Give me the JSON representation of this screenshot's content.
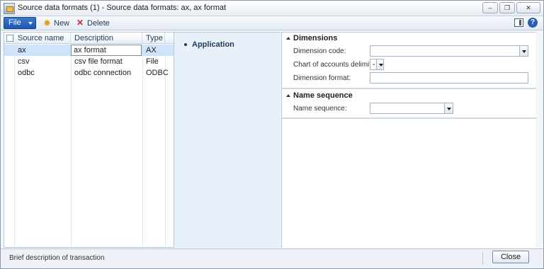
{
  "window": {
    "title": "Source data formats (1) - Source data formats: ax, ax format",
    "controls": [
      "minimize",
      "restore",
      "close"
    ]
  },
  "toolbar": {
    "file_label": "File",
    "new_label": "New",
    "delete_label": "Delete"
  },
  "grid": {
    "columns": [
      "Source name",
      "Description",
      "Type"
    ],
    "sort_column": "Source name",
    "rows": [
      {
        "name": "ax",
        "description": "ax format",
        "type": "AX",
        "selected": true
      },
      {
        "name": "csv",
        "description": "csv file format",
        "type": "File",
        "selected": false
      },
      {
        "name": "odbc",
        "description": "odbc connection",
        "type": "ODBC",
        "selected": false
      }
    ]
  },
  "nav": {
    "items": [
      "Application"
    ]
  },
  "detail": {
    "dimensions": {
      "title": "Dimensions",
      "dimension_code_label": "Dimension code:",
      "dimension_code_value": "",
      "delimiter_label": "Chart of accounts delimiter:",
      "delimiter_value": "-",
      "dimension_format_label": "Dimension format:",
      "dimension_format_value": ""
    },
    "name_sequence": {
      "title": "Name sequence",
      "label": "Name sequence:",
      "value": ""
    }
  },
  "status": {
    "description": "Brief description of transaction",
    "close_label": "Close"
  },
  "colors": {
    "file_button": "#1d57b0",
    "selected_row": "#cfe3fa",
    "nav_panel": "#e8f0fa",
    "text": "#1e395b"
  }
}
